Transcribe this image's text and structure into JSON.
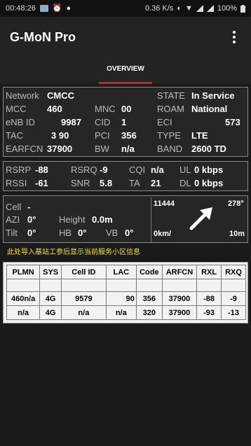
{
  "status_bar": {
    "time": "00:48:26",
    "speed": "0.36 K/s",
    "battery": "100%"
  },
  "app": {
    "title": "G-MoN Pro"
  },
  "tabs": [
    {
      "label": "OVERVIEW"
    }
  ],
  "network_panel": {
    "network_label": "Network",
    "network_value": "CMCC",
    "state_label": "STATE",
    "state_value": "In Service",
    "mcc_label": "MCC",
    "mcc_value": "460",
    "mnc_label": "MNC",
    "mnc_value": "00",
    "roam_label": "ROAM",
    "roam_value": "National",
    "enb_label": "eNB ID",
    "enb_value": "9987",
    "cid_label": "CID",
    "cid_value": "1",
    "eci_label": "ECI",
    "eci_value": "573",
    "tac_label": "TAC",
    "tac_value": "3 90",
    "pci_label": "PCI",
    "pci_value": "356",
    "type_label": "TYPE",
    "type_value": "LTE",
    "earfcn_label": "EARFCN",
    "earfcn_value": "37900",
    "bw_label": "BW",
    "bw_value": "n/a",
    "band_label": "BAND",
    "band_value": "2600 TD"
  },
  "signal_panel": {
    "rsrp_label": "RSRP",
    "rsrp_value": "-88",
    "rsrq_label": "RSRQ",
    "rsrq_value": "-9",
    "cqi_label": "CQI",
    "cqi_value": "n/a",
    "ul_label": "UL",
    "ul_value": "0 kbps",
    "rssi_label": "RSSI",
    "rssi_value": "-61",
    "snr_label": "SNR",
    "snr_value": "5.8",
    "ta_label": "TA",
    "ta_value": "21",
    "dl_label": "DL",
    "dl_value": "0 kbps"
  },
  "site_panel": {
    "cell_label": "Cell",
    "cell_value": "-",
    "azi_label": "AZI",
    "azi_value": "0°",
    "height_label": "Height",
    "height_value": "0.0m",
    "tilt_label": "Tilt",
    "tilt_value": "0°",
    "hb_label": "HB",
    "hb_value": "0°",
    "vb_label": "VB",
    "vb_value": "0°",
    "site_id": "11444",
    "bearing": "278°",
    "distance_left": "0km/",
    "distance_right": "10m"
  },
  "hint_text": "此处导入基站工参后显示当前服务小区信息",
  "cell_table": {
    "headers": [
      "PLMN",
      "SYS",
      "Cell ID",
      "LAC",
      "Code",
      "ARFCN",
      "RXL",
      "RXQ"
    ],
    "rows": [
      [
        "460n/a",
        "4G",
        "9579",
        "90",
        "356",
        "37900",
        "-88",
        "-9"
      ],
      [
        "n/a",
        "4G",
        "n/a",
        "n/a",
        "320",
        "37900",
        "-93",
        "-13"
      ]
    ]
  },
  "colors": {
    "accent": "#d21e26",
    "hint": "#f5e13a",
    "background": "#1a1a1a"
  }
}
